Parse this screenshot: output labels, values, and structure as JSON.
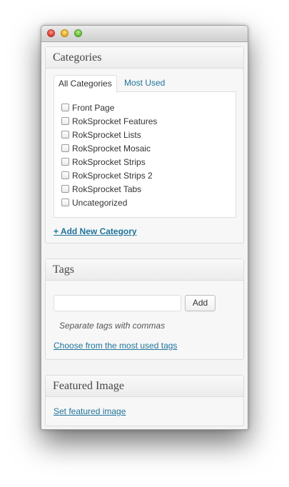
{
  "window": {
    "traffic_lights": [
      "close",
      "minimize",
      "zoom"
    ]
  },
  "categories_box": {
    "title": "Categories",
    "tabs": [
      {
        "label": "All Categories",
        "active": true
      },
      {
        "label": "Most Used",
        "active": false
      }
    ],
    "items": [
      {
        "label": "Front Page",
        "checked": false
      },
      {
        "label": "RokSprocket Features",
        "checked": false
      },
      {
        "label": "RokSprocket Lists",
        "checked": false
      },
      {
        "label": "RokSprocket Mosaic",
        "checked": false
      },
      {
        "label": "RokSprocket Strips",
        "checked": false
      },
      {
        "label": "RokSprocket Strips 2",
        "checked": false
      },
      {
        "label": "RokSprocket Tabs",
        "checked": false
      },
      {
        "label": "Uncategorized",
        "checked": false
      }
    ],
    "add_link": "+ Add New Category"
  },
  "tags_box": {
    "title": "Tags",
    "input_value": "",
    "add_button": "Add",
    "hint": "Separate tags with commas",
    "choose_link": "Choose from the most used tags"
  },
  "featured_box": {
    "title": "Featured Image",
    "set_link": "Set featured image"
  },
  "colors": {
    "link": "#21759b",
    "panel_background": "#f7f7f7",
    "header_text": "#464646"
  }
}
